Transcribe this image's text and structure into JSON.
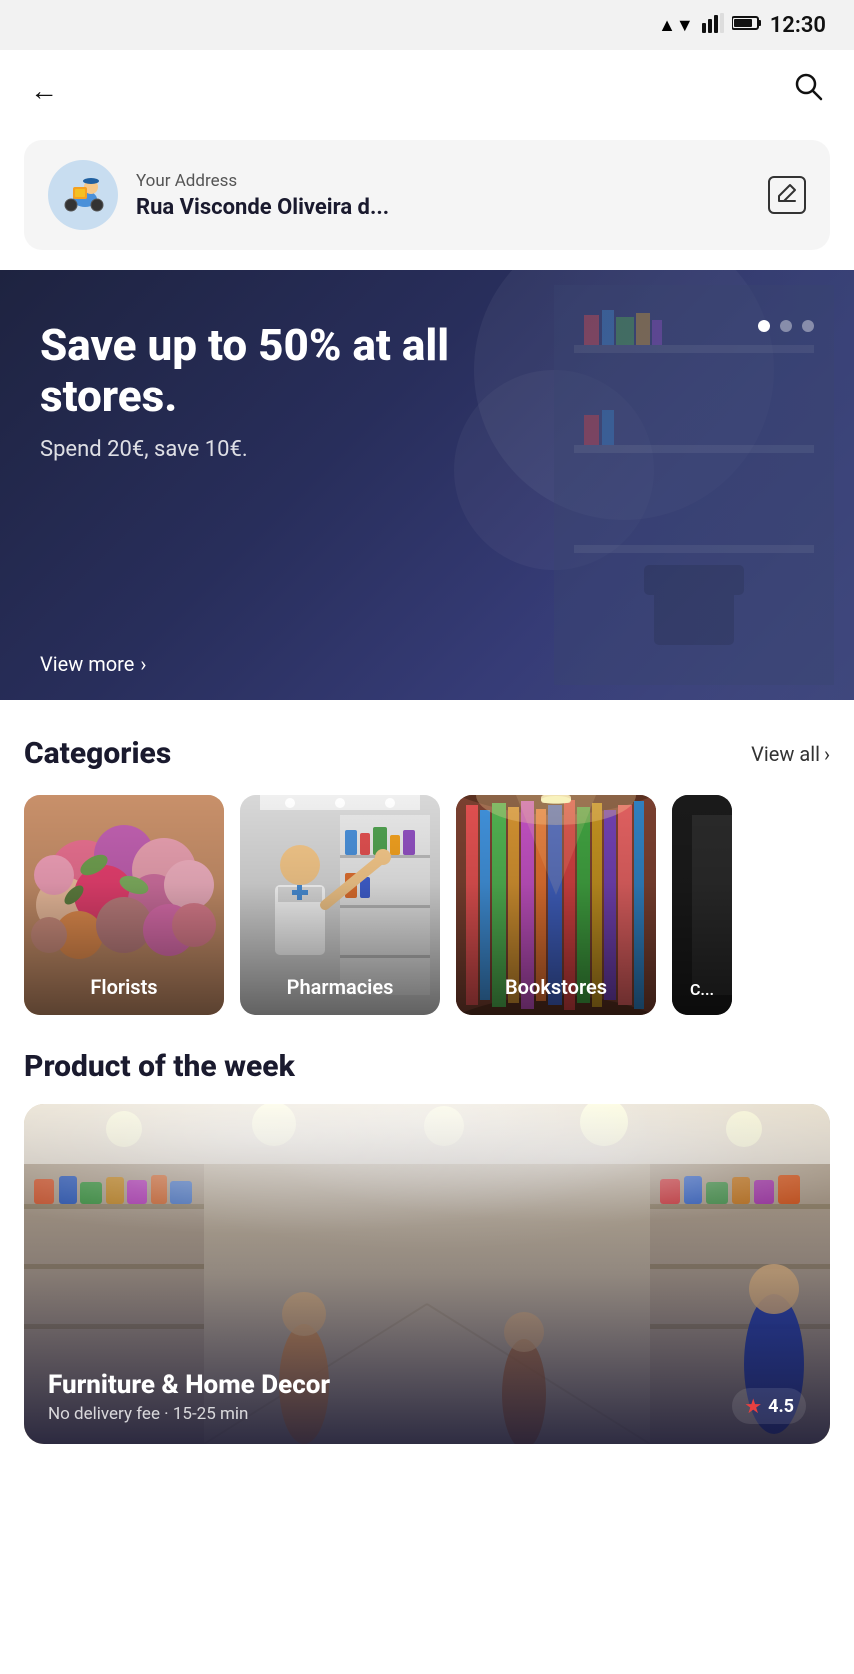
{
  "status_bar": {
    "time": "12:30",
    "wifi_icon": "▼",
    "signal_icon": "▲",
    "battery_icon": "🔋"
  },
  "nav": {
    "back_label": "←",
    "search_label": "🔍"
  },
  "address": {
    "label": "Your Address",
    "value": "Rua Visconde Oliveira d...",
    "edit_icon": "✏"
  },
  "banner": {
    "title": "Save up to 50% at all stores.",
    "subtitle": "Spend 20€, save 10€.",
    "view_more": "View more",
    "dots": [
      true,
      false,
      false
    ]
  },
  "categories": {
    "title": "Categories",
    "view_all": "View all",
    "items": [
      {
        "name": "Florists",
        "type": "florists"
      },
      {
        "name": "Pharmacies",
        "type": "pharmacies"
      },
      {
        "name": "Bookstores",
        "type": "bookstores"
      },
      {
        "name": "C...",
        "type": "fourth"
      }
    ]
  },
  "product_of_week": {
    "section_title": "Product of the week",
    "product_name": "Furniture & Home Decor",
    "product_desc": "No delivery fee · 15-25 min",
    "rating": "4.5"
  }
}
